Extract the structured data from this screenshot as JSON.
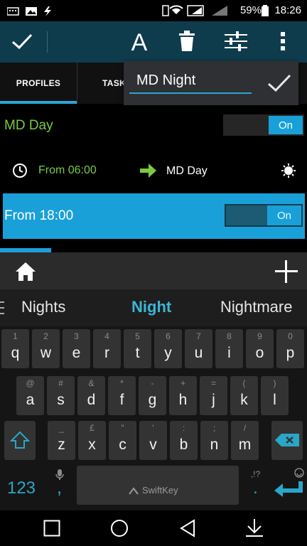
{
  "status_bar": {
    "battery": "59%",
    "time": "18:26"
  },
  "tabs": {
    "profiles": "PROFILES",
    "tasks_partial": "TASK"
  },
  "name_popup": {
    "value": "MD Night"
  },
  "profile_day": {
    "name": "MD Day",
    "toggle": "On"
  },
  "context_row": {
    "from": "From 06:00",
    "task": "MD Day"
  },
  "profile_selected": {
    "label": "From 18:00",
    "toggle": "On"
  },
  "suggestions": {
    "left": "Nights",
    "center": "Night",
    "right": "Nightmare"
  },
  "keyboard": {
    "row1": [
      [
        "1",
        "q"
      ],
      [
        "2",
        "w"
      ],
      [
        "3",
        "e"
      ],
      [
        "4",
        "r"
      ],
      [
        "5",
        "t"
      ],
      [
        "6",
        "y"
      ],
      [
        "7",
        "u"
      ],
      [
        "8",
        "i"
      ],
      [
        "9",
        "o"
      ],
      [
        "0",
        "p"
      ]
    ],
    "row2": [
      [
        "@",
        "a"
      ],
      [
        "#",
        "s"
      ],
      [
        "&",
        "d"
      ],
      [
        "*",
        "f"
      ],
      [
        "-",
        "g"
      ],
      [
        "+",
        "h"
      ],
      [
        "=",
        "j"
      ],
      [
        "(",
        "k"
      ],
      [
        ")",
        "l"
      ]
    ],
    "row3": [
      [
        "_",
        "z"
      ],
      [
        "£",
        "x"
      ],
      [
        "\"",
        "c"
      ],
      [
        "'",
        "v"
      ],
      [
        ":",
        "b"
      ],
      [
        ";",
        "n"
      ],
      [
        "/",
        "m"
      ]
    ],
    "numbers_key": "123",
    "comma_key": ",",
    "period_key": ".",
    "punct_hint": ",!?",
    "brand": "SwiftKey"
  },
  "colors": {
    "accent": "#1aa0d8",
    "actionbar": "#0e3c4d",
    "green": "#7ac943"
  }
}
